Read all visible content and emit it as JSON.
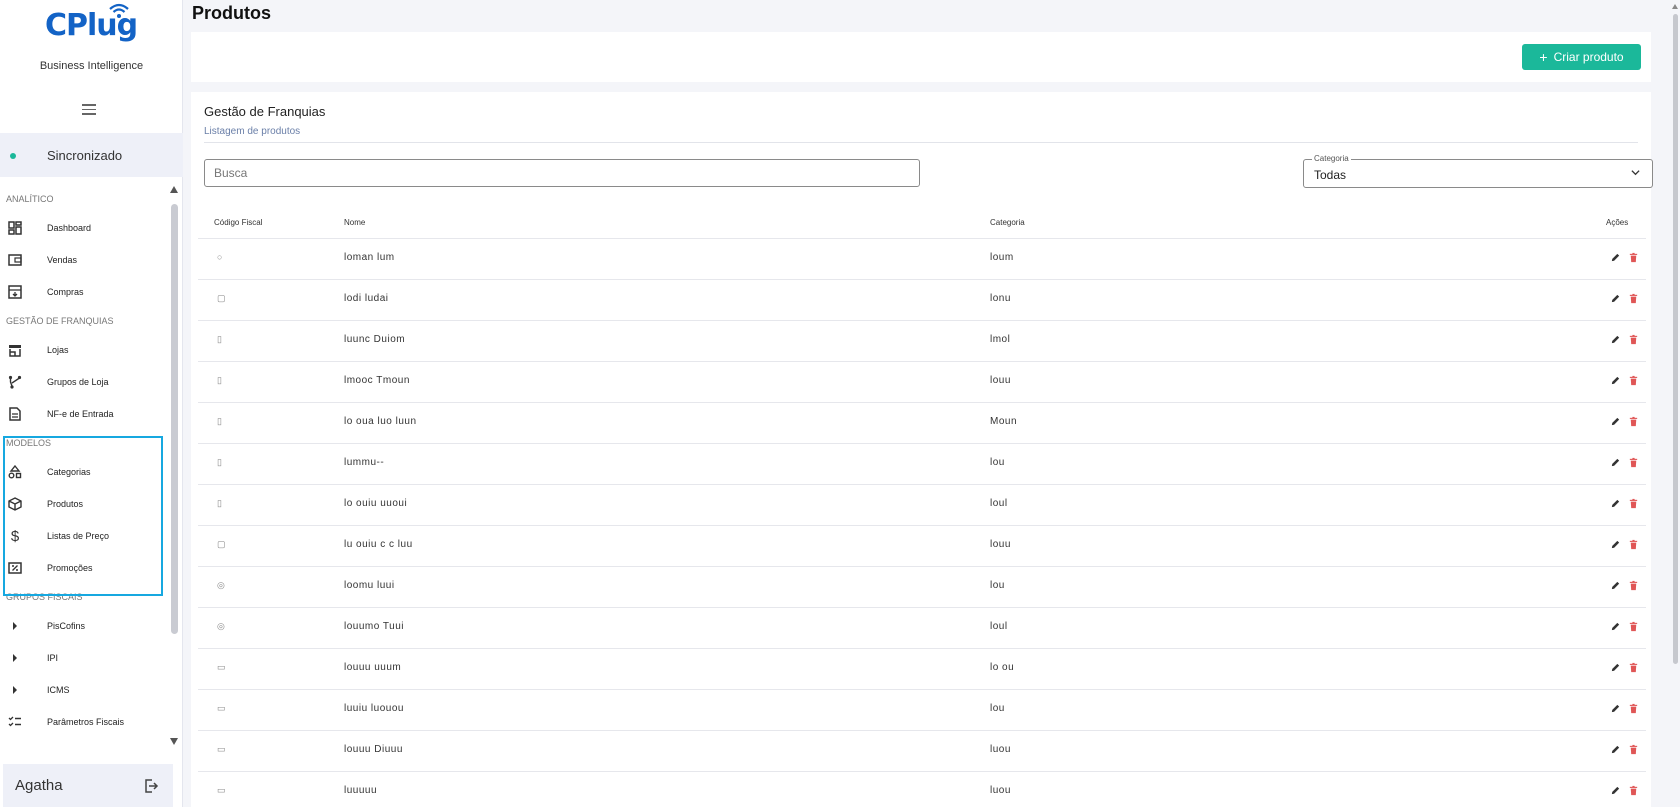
{
  "sidebar": {
    "brand": "CPlug",
    "subtitle": "Business Intelligence",
    "sync_label": "Sincronizado",
    "sections": {
      "analitico": "ANALÍTICO",
      "franquias": "GESTÃO DE FRANQUIAS",
      "modelos": "MODELOS",
      "fiscais": "GRUPOS FISCAIS"
    },
    "items": {
      "dashboard": "Dashboard",
      "vendas": "Vendas",
      "compras": "Compras",
      "lojas": "Lojas",
      "grupos": "Grupos de Loja",
      "nfe": "NF-e de Entrada",
      "categorias": "Categorias",
      "produtos": "Produtos",
      "listas": "Listas de Preço",
      "promocoes": "Promoções",
      "piscofins": "PisCofins",
      "ipi": "IPI",
      "icms": "ICMS",
      "parametros": "Parâmetros Fiscais"
    },
    "user_name": "Agatha"
  },
  "header": {
    "title": "Produtos",
    "create_button": "Criar produto"
  },
  "card": {
    "title": "Gestão de Franquias",
    "subtitle": "Listagem de produtos",
    "search_placeholder": "Busca",
    "category_legend": "Categoria",
    "category_value": "Todas"
  },
  "table": {
    "headers": {
      "code": "Código Fiscal",
      "name": "Nome",
      "category": "Categoria",
      "actions": "Ações"
    },
    "rows": [
      {
        "code": "○",
        "name": "lоman lum",
        "category": "lоum"
      },
      {
        "code": "▢",
        "name": "lodi ludai",
        "category": "lonu"
      },
      {
        "code": "▯",
        "name": "luunc Duiom",
        "category": "lmol"
      },
      {
        "code": "▯",
        "name": "lmooc Tmoun",
        "category": "louu"
      },
      {
        "code": "▯",
        "name": "lo oua luo luun",
        "category": "Moun"
      },
      {
        "code": "▯",
        "name": "lummu--",
        "category": "lou"
      },
      {
        "code": "▯",
        "name": "lo ouiu uuoui",
        "category": "loul"
      },
      {
        "code": "▢",
        "name": "lu ouiu c  c  luu",
        "category": "louu"
      },
      {
        "code": "◎",
        "name": "loomu luui",
        "category": "lou"
      },
      {
        "code": "◎",
        "name": "louumo Tuui",
        "category": "loul"
      },
      {
        "code": "▭",
        "name": "louuu uuum",
        "category": "lo ou"
      },
      {
        "code": "▭",
        "name": "luuiu luouou",
        "category": "lou"
      },
      {
        "code": "▭",
        "name": "louuu Diuuu",
        "category": "luou"
      },
      {
        "code": "▭",
        "name": "luuuuu",
        "category": "luou"
      }
    ]
  }
}
